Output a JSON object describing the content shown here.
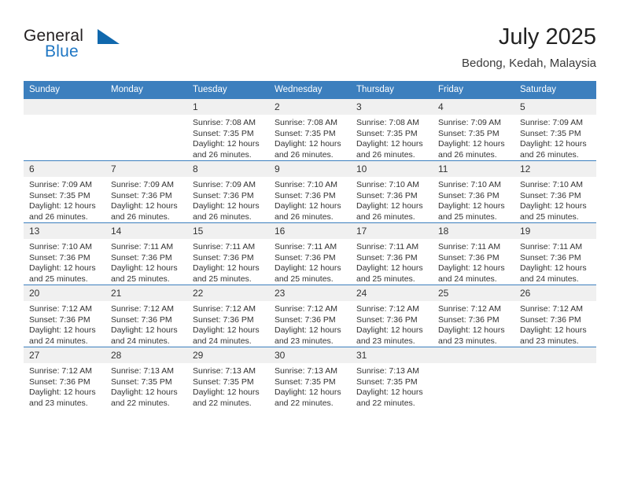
{
  "brand": {
    "name_top": "General",
    "name_bottom": "Blue",
    "triangle_color": "#1068ad",
    "blue_color": "#1f77c4"
  },
  "header": {
    "title": "July 2025",
    "location": "Bedong, Kedah, Malaysia"
  },
  "theme": {
    "header_row_color": "#3c7fbe",
    "daynum_band_color": "#f0f0f0",
    "text_color": "#333333"
  },
  "weekday_headers": [
    "Sunday",
    "Monday",
    "Tuesday",
    "Wednesday",
    "Thursday",
    "Friday",
    "Saturday"
  ],
  "weeks": [
    [
      {
        "day": "",
        "lines": []
      },
      {
        "day": "",
        "lines": []
      },
      {
        "day": "1",
        "lines": [
          "Sunrise: 7:08 AM",
          "Sunset: 7:35 PM",
          "Daylight: 12 hours",
          "and 26 minutes."
        ]
      },
      {
        "day": "2",
        "lines": [
          "Sunrise: 7:08 AM",
          "Sunset: 7:35 PM",
          "Daylight: 12 hours",
          "and 26 minutes."
        ]
      },
      {
        "day": "3",
        "lines": [
          "Sunrise: 7:08 AM",
          "Sunset: 7:35 PM",
          "Daylight: 12 hours",
          "and 26 minutes."
        ]
      },
      {
        "day": "4",
        "lines": [
          "Sunrise: 7:09 AM",
          "Sunset: 7:35 PM",
          "Daylight: 12 hours",
          "and 26 minutes."
        ]
      },
      {
        "day": "5",
        "lines": [
          "Sunrise: 7:09 AM",
          "Sunset: 7:35 PM",
          "Daylight: 12 hours",
          "and 26 minutes."
        ]
      }
    ],
    [
      {
        "day": "6",
        "lines": [
          "Sunrise: 7:09 AM",
          "Sunset: 7:35 PM",
          "Daylight: 12 hours",
          "and 26 minutes."
        ]
      },
      {
        "day": "7",
        "lines": [
          "Sunrise: 7:09 AM",
          "Sunset: 7:36 PM",
          "Daylight: 12 hours",
          "and 26 minutes."
        ]
      },
      {
        "day": "8",
        "lines": [
          "Sunrise: 7:09 AM",
          "Sunset: 7:36 PM",
          "Daylight: 12 hours",
          "and 26 minutes."
        ]
      },
      {
        "day": "9",
        "lines": [
          "Sunrise: 7:10 AM",
          "Sunset: 7:36 PM",
          "Daylight: 12 hours",
          "and 26 minutes."
        ]
      },
      {
        "day": "10",
        "lines": [
          "Sunrise: 7:10 AM",
          "Sunset: 7:36 PM",
          "Daylight: 12 hours",
          "and 26 minutes."
        ]
      },
      {
        "day": "11",
        "lines": [
          "Sunrise: 7:10 AM",
          "Sunset: 7:36 PM",
          "Daylight: 12 hours",
          "and 25 minutes."
        ]
      },
      {
        "day": "12",
        "lines": [
          "Sunrise: 7:10 AM",
          "Sunset: 7:36 PM",
          "Daylight: 12 hours",
          "and 25 minutes."
        ]
      }
    ],
    [
      {
        "day": "13",
        "lines": [
          "Sunrise: 7:10 AM",
          "Sunset: 7:36 PM",
          "Daylight: 12 hours",
          "and 25 minutes."
        ]
      },
      {
        "day": "14",
        "lines": [
          "Sunrise: 7:11 AM",
          "Sunset: 7:36 PM",
          "Daylight: 12 hours",
          "and 25 minutes."
        ]
      },
      {
        "day": "15",
        "lines": [
          "Sunrise: 7:11 AM",
          "Sunset: 7:36 PM",
          "Daylight: 12 hours",
          "and 25 minutes."
        ]
      },
      {
        "day": "16",
        "lines": [
          "Sunrise: 7:11 AM",
          "Sunset: 7:36 PM",
          "Daylight: 12 hours",
          "and 25 minutes."
        ]
      },
      {
        "day": "17",
        "lines": [
          "Sunrise: 7:11 AM",
          "Sunset: 7:36 PM",
          "Daylight: 12 hours",
          "and 25 minutes."
        ]
      },
      {
        "day": "18",
        "lines": [
          "Sunrise: 7:11 AM",
          "Sunset: 7:36 PM",
          "Daylight: 12 hours",
          "and 24 minutes."
        ]
      },
      {
        "day": "19",
        "lines": [
          "Sunrise: 7:11 AM",
          "Sunset: 7:36 PM",
          "Daylight: 12 hours",
          "and 24 minutes."
        ]
      }
    ],
    [
      {
        "day": "20",
        "lines": [
          "Sunrise: 7:12 AM",
          "Sunset: 7:36 PM",
          "Daylight: 12 hours",
          "and 24 minutes."
        ]
      },
      {
        "day": "21",
        "lines": [
          "Sunrise: 7:12 AM",
          "Sunset: 7:36 PM",
          "Daylight: 12 hours",
          "and 24 minutes."
        ]
      },
      {
        "day": "22",
        "lines": [
          "Sunrise: 7:12 AM",
          "Sunset: 7:36 PM",
          "Daylight: 12 hours",
          "and 24 minutes."
        ]
      },
      {
        "day": "23",
        "lines": [
          "Sunrise: 7:12 AM",
          "Sunset: 7:36 PM",
          "Daylight: 12 hours",
          "and 23 minutes."
        ]
      },
      {
        "day": "24",
        "lines": [
          "Sunrise: 7:12 AM",
          "Sunset: 7:36 PM",
          "Daylight: 12 hours",
          "and 23 minutes."
        ]
      },
      {
        "day": "25",
        "lines": [
          "Sunrise: 7:12 AM",
          "Sunset: 7:36 PM",
          "Daylight: 12 hours",
          "and 23 minutes."
        ]
      },
      {
        "day": "26",
        "lines": [
          "Sunrise: 7:12 AM",
          "Sunset: 7:36 PM",
          "Daylight: 12 hours",
          "and 23 minutes."
        ]
      }
    ],
    [
      {
        "day": "27",
        "lines": [
          "Sunrise: 7:12 AM",
          "Sunset: 7:36 PM",
          "Daylight: 12 hours",
          "and 23 minutes."
        ]
      },
      {
        "day": "28",
        "lines": [
          "Sunrise: 7:13 AM",
          "Sunset: 7:35 PM",
          "Daylight: 12 hours",
          "and 22 minutes."
        ]
      },
      {
        "day": "29",
        "lines": [
          "Sunrise: 7:13 AM",
          "Sunset: 7:35 PM",
          "Daylight: 12 hours",
          "and 22 minutes."
        ]
      },
      {
        "day": "30",
        "lines": [
          "Sunrise: 7:13 AM",
          "Sunset: 7:35 PM",
          "Daylight: 12 hours",
          "and 22 minutes."
        ]
      },
      {
        "day": "31",
        "lines": [
          "Sunrise: 7:13 AM",
          "Sunset: 7:35 PM",
          "Daylight: 12 hours",
          "and 22 minutes."
        ]
      },
      {
        "day": "",
        "lines": []
      },
      {
        "day": "",
        "lines": []
      }
    ]
  ]
}
